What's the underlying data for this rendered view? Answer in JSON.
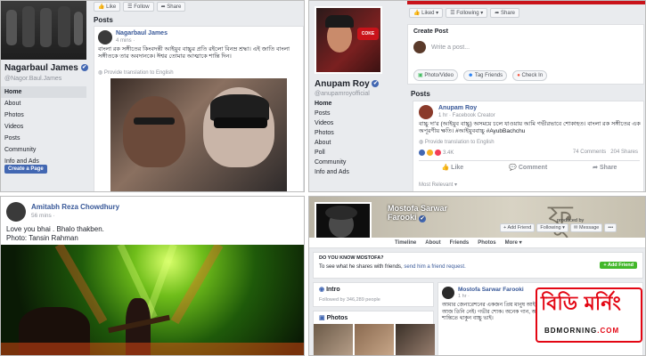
{
  "p1": {
    "toolbar": [
      "Like",
      "Follow",
      "Share"
    ],
    "page_name": "Nagarbaul James",
    "page_handle": "@Nagor.Baul.James",
    "nav": [
      "Home",
      "About",
      "Photos",
      "Videos",
      "Posts",
      "Community",
      "Info and Ads"
    ],
    "create_page": "Create a Page",
    "posts_header": "Posts",
    "post_author": "Nagarbaul James",
    "post_time": "4 mins ·",
    "post_text": "বাংলা রক সঙ্গীতের কিংবদন্তী আইয়ুব বাচ্চুর প্রতি রইলো বিনম্র শ্রদ্ধা। এই জাতি বাংলা সঙ্গীতকে তার অবদানকে। ঈশ্বর তোমার আত্মাকে শান্তি দিন।",
    "translate": "Provide translation to English"
  },
  "p2": {
    "toolbar": [
      "Liked",
      "Following",
      "Share"
    ],
    "name": "Anupam Roy",
    "handle": "@anupamroyofficial",
    "nav": [
      "Home",
      "Posts",
      "Videos",
      "Photos",
      "About",
      "Poll",
      "Community",
      "Info and Ads"
    ],
    "create_post": "Create Post",
    "write_placeholder": "Write a post...",
    "actions": [
      "Photo/Video",
      "Tag Friends",
      "Check In"
    ],
    "posts_header": "Posts",
    "post_author": "Anupam Roy",
    "post_meta": "1 hr · Facebook Creator",
    "post_text": "বাচ্চু দা'র (আইয়ুব বাচ্চু) অসময়ে চলে যাওয়ায় আমি গভীরভাবে শোকাহত। বাংলা রক সঙ্গীতের এক অপূরণীয় ক্ষতি। #আইয়ুববাচ্চু #AyubBachchu",
    "translate": "Provide translation to English",
    "reactions": "3.4K",
    "comments": "74 Comments",
    "shares": "204 Shares",
    "buttons": [
      "Like",
      "Comment",
      "Share"
    ],
    "most_relevant": "Most Relevant"
  },
  "p3": {
    "author": "Amitabh Reza Chowdhury",
    "time": "56 mins ·",
    "line1": "Love you bhai . Bhalo thakben.",
    "line2": "Photo: Tansin Rahman"
  },
  "p4": {
    "name_line1": "Mostofa Sarwar",
    "name_line2": "Farooki",
    "verified": "✔",
    "add_friend": "Add Friend",
    "following": "Following",
    "message": "Message",
    "produced_by": "produced by",
    "tabs": [
      "Timeline",
      "About",
      "Friends",
      "Photos",
      "More"
    ],
    "do_you_know": "DO YOU KNOW MOSTOFA?",
    "see_shares": "To see what he shares with friends,",
    "send_request": "send him a friend request.",
    "add_friend2": "Add Friend",
    "intro": "Intro",
    "followed_by": "Followed by 346,289 people",
    "photos": "Photos",
    "post_author": "Mostofa Sarwar Farooki",
    "post_time": "1 hr ·",
    "post_text": "আমার জেনারেশনের একজন প্রিয় মানুষ আইয়ুব বাচ্চু। আজ তিনি নেই। গভীর শোক। অনেক গান, অনেক স্মৃতি। শান্তিতে থাকুন বাচ্চু ভাই।",
    "watermark_text": "বিডি মর্নিং",
    "watermark_sub": "BDMORNING",
    "watermark_tld": ".COM"
  },
  "colors": {
    "fb_blue": "#4267b2",
    "link": "#385898",
    "bd_red": "#e30613"
  }
}
